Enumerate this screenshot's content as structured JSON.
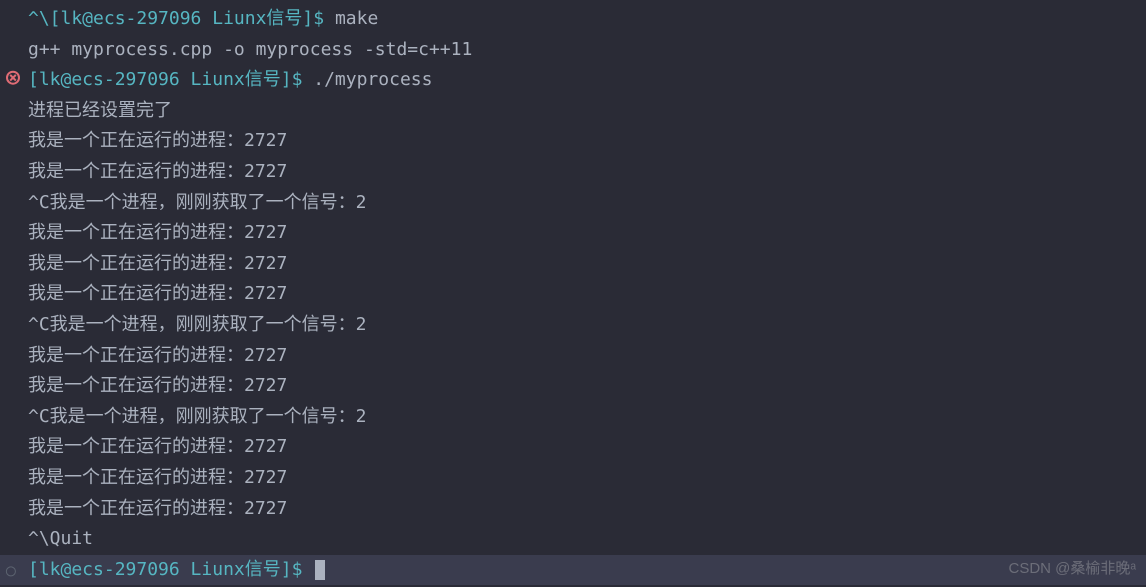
{
  "lines": {
    "l0_prompt": "^\\[lk@ecs-297096 Liunx信号]$ ",
    "l0_cmd": "make",
    "l1": "g++ myprocess.cpp -o myprocess -std=c++11",
    "l2_prompt": "[lk@ecs-297096 Liunx信号]$ ",
    "l2_cmd": "./myprocess",
    "l3": "进程已经设置完了",
    "l4": "我是一个正在运行的进程：2727",
    "l5": "我是一个正在运行的进程：2727",
    "l6": "^C我是一个进程，刚刚获取了一个信号：2",
    "l7": "我是一个正在运行的进程：2727",
    "l8": "我是一个正在运行的进程：2727",
    "l9": "我是一个正在运行的进程：2727",
    "l10": "^C我是一个进程，刚刚获取了一个信号：2",
    "l11": "我是一个正在运行的进程：2727",
    "l12": "我是一个正在运行的进程：2727",
    "l13": "^C我是一个进程，刚刚获取了一个信号：2",
    "l14": "我是一个正在运行的进程：2727",
    "l15": "我是一个正在运行的进程：2727",
    "l16": "我是一个正在运行的进程：2727",
    "l17": "^\\Quit",
    "l18_prompt": "[lk@ecs-297096 Liunx信号]$ "
  },
  "watermark": "CSDN @桑榆非晚ᵃ"
}
